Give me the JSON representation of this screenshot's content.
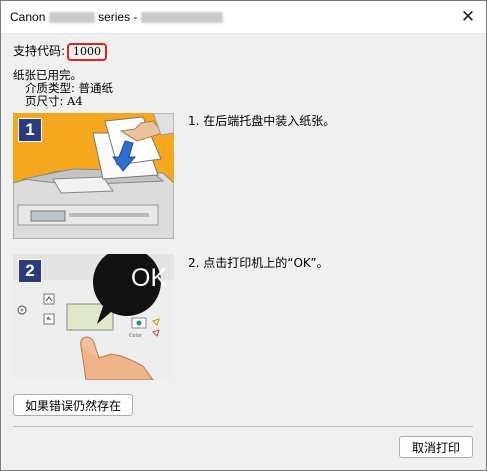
{
  "window": {
    "title_prefix": "Canon",
    "title_series": "series -"
  },
  "support": {
    "label": "支持代码:",
    "code": "1000"
  },
  "status": {
    "message": "纸张已用完。",
    "media_type_label": "介质类型:",
    "media_type_value": "普通纸",
    "page_size_label": "页尺寸:",
    "page_size_value": "A4"
  },
  "steps": [
    {
      "number": "1",
      "text": "1.  在后端托盘中装入纸张。"
    },
    {
      "number": "2",
      "text": "2.  点击打印机上的“OK”。",
      "ok_label": "OK",
      "color_label": "Color"
    }
  ],
  "buttons": {
    "if_error_persists": "如果错误仍然存在",
    "cancel_print": "取消打印"
  },
  "colors": {
    "step1_background": "#f5a81d",
    "step_badge": "#2b3b7d",
    "code_highlight": "#e2231a"
  }
}
